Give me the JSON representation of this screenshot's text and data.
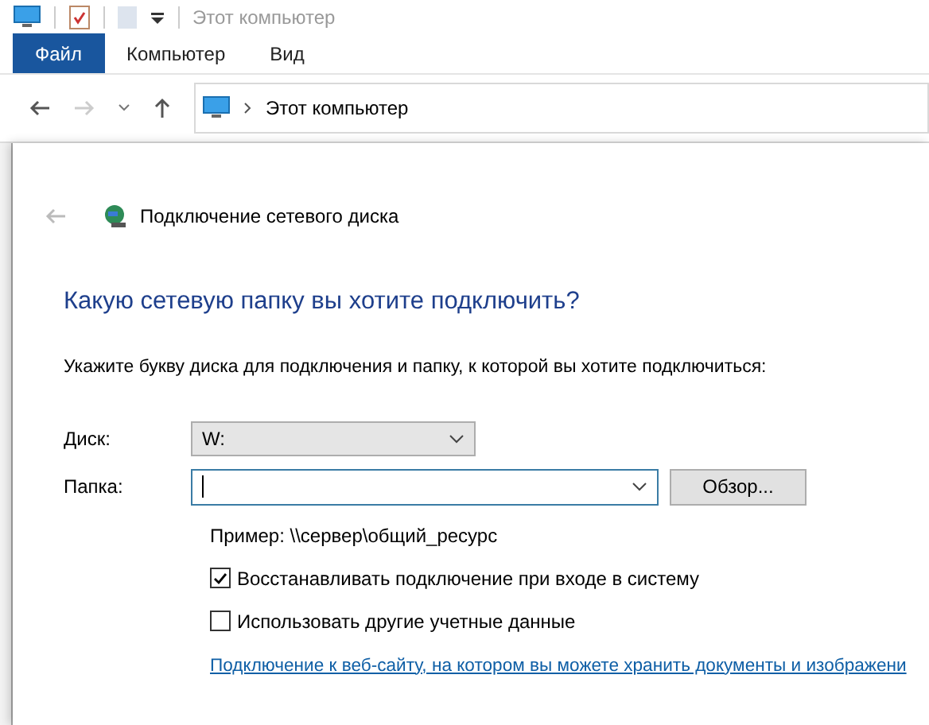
{
  "window": {
    "title": "Этот компьютер"
  },
  "ribbon_tabs": [
    {
      "label": "Файл",
      "selected": true
    },
    {
      "label": "Компьютер",
      "selected": false
    },
    {
      "label": "Вид",
      "selected": false
    }
  ],
  "address_bar": {
    "path": "Этот компьютер"
  },
  "dialog": {
    "title": "Подключение сетевого диска",
    "heading": "Какую сетевую папку вы хотите подключить?",
    "instruction": "Укажите букву диска для подключения и папку, к которой вы хотите подключиться:",
    "drive": {
      "label": "Диск:",
      "value": "W:"
    },
    "folder": {
      "label": "Папка:",
      "browse": "Обзор..."
    },
    "example": "Пример: \\\\сервер\\общий_ресурс",
    "options": [
      {
        "label": "Восстанавливать подключение при входе в систему",
        "checked": true
      },
      {
        "label": "Использовать другие учетные данные",
        "checked": false
      }
    ],
    "link": "Подключение к веб-сайту, на котором вы можете хранить документы и изображени"
  }
}
